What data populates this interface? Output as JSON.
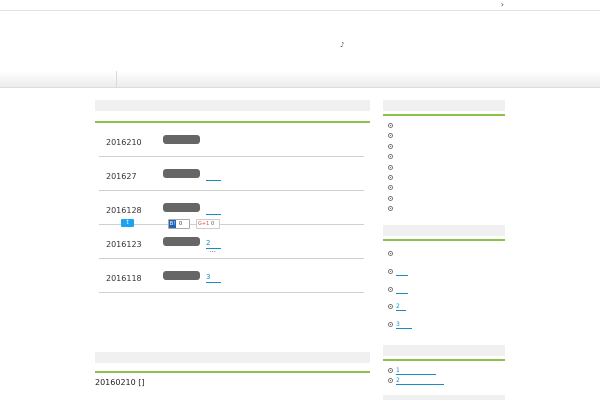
{
  "topbar": {
    "chevron": "›"
  },
  "header": {
    "logo_mark": "♪"
  },
  "main": {
    "news": [
      {
        "date": "2016210",
        "link": ""
      },
      {
        "date": "201627",
        "link": ""
      },
      {
        "date": "2016128",
        "link": ""
      },
      {
        "date": "2016123",
        "link": "2",
        "more": "…"
      },
      {
        "date": "2016118",
        "link": "3"
      }
    ],
    "share": {
      "twitter_icon": "t",
      "hatena_icon": "B!",
      "hatena_count": "0",
      "gplus_label": "G+1",
      "gplus_count": "0"
    },
    "post_title": "20160210 []"
  },
  "sidebar": {
    "widget2_links": [
      "",
      "",
      "2",
      "3"
    ],
    "widget3_links": [
      "1",
      "2"
    ]
  },
  "colors": {
    "accent_rule": "#8bc34a",
    "link": "#1a8bc2",
    "badge": "#666666"
  }
}
